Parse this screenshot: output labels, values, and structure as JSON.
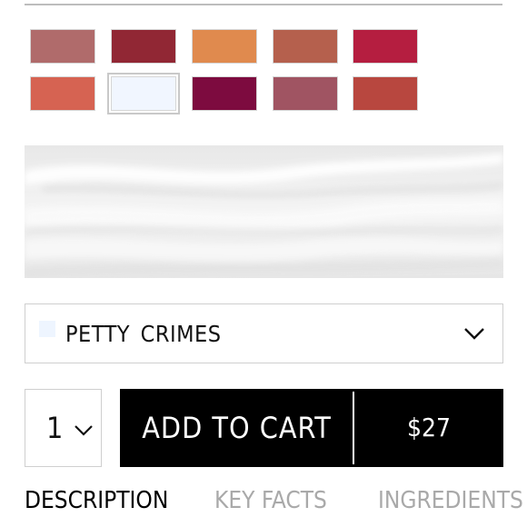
{
  "swatches": [
    {
      "color": "#b06b6b",
      "label": ""
    },
    {
      "color": "#912734",
      "label": ""
    },
    {
      "color": "#e08a4e",
      "label": ""
    },
    {
      "color": "#b5604d",
      "label": ""
    },
    {
      "color": "#b51e40",
      "label": ""
    },
    {
      "color": "#d66352",
      "label": ""
    },
    {
      "color": "#f1f6ff",
      "label": "",
      "selected": true
    },
    {
      "color": "#7d0b3f",
      "label": ""
    },
    {
      "color": "#a05462",
      "label": ""
    },
    {
      "color": "#b8473f",
      "label": ""
    }
  ],
  "shade_select": {
    "selected_name": "PETTY CRIMES",
    "chip_color": "#eef5ff",
    "icon": "chevron-down-icon"
  },
  "quantity": {
    "value": "1",
    "icon": "chevron-down-icon"
  },
  "cart": {
    "label": "ADD TO CART",
    "price": "$27"
  },
  "tabs": [
    {
      "label": "DESCRIPTION",
      "active": true
    },
    {
      "label": "KEY FACTS",
      "active": false
    },
    {
      "label": "INGREDIENTS",
      "active": false
    }
  ]
}
